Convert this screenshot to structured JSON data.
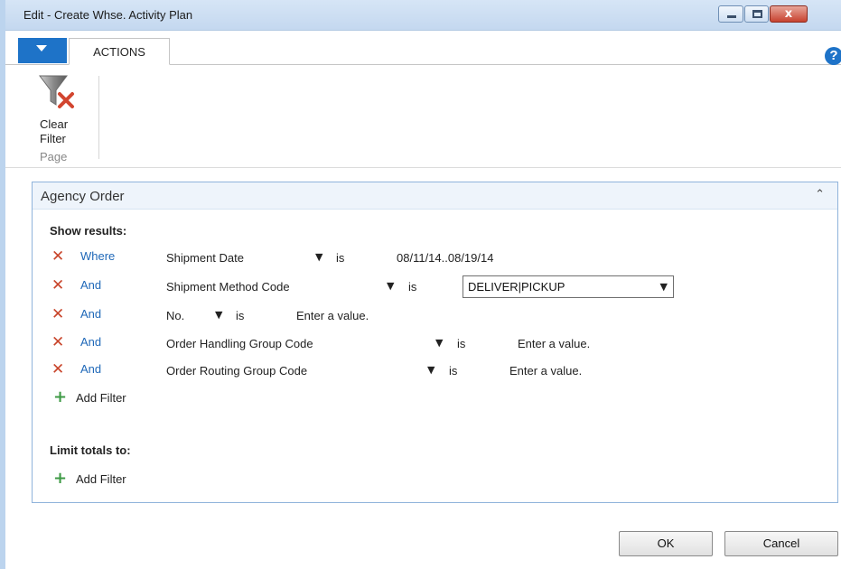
{
  "window": {
    "title": "Edit - Create Whse. Activity Plan",
    "close_glyph": "x"
  },
  "ribbon": {
    "tabs": [
      {
        "label": "ACTIONS"
      }
    ],
    "help_glyph": "?",
    "clear_filter_label": "Clear\nFilter",
    "group_label": "Page"
  },
  "panel": {
    "title": "Agency Order",
    "show_results_label": "Show results:",
    "filters": [
      {
        "conjunction": "Where",
        "field": "Shipment Date",
        "operator": "is",
        "value": "08/11/14..08/19/14",
        "placeholder": false
      },
      {
        "conjunction": "And",
        "field": "Shipment Method Code",
        "operator": "is",
        "value": "DELIVER|PICKUP",
        "placeholder": false,
        "editing": true
      },
      {
        "conjunction": "And",
        "field": "No.",
        "operator": "is",
        "value": "Enter a value.",
        "placeholder": true
      },
      {
        "conjunction": "And",
        "field": "Order Handling Group Code",
        "operator": "is",
        "value": "Enter a value.",
        "placeholder": true
      },
      {
        "conjunction": "And",
        "field": "Order Routing Group Code",
        "operator": "is",
        "value": "Enter a value.",
        "placeholder": true
      }
    ],
    "add_filter_label": "Add Filter",
    "limit_totals_label": "Limit totals to:",
    "limit_add_filter_label": "Add Filter"
  },
  "buttons": {
    "ok_label": "OK",
    "cancel_label": "Cancel"
  },
  "colors": {
    "accent": "#1e73c8",
    "remove_icon": "#c8442a",
    "add_icon": "#3e9a45",
    "conjunction_text": "#1f68b8"
  },
  "icons": {
    "remove": "remove-filter-icon",
    "add": "add-filter-icon",
    "clear_filter": "clear-filter-icon",
    "help": "help-icon",
    "collapse": "chevron-up-icon"
  }
}
